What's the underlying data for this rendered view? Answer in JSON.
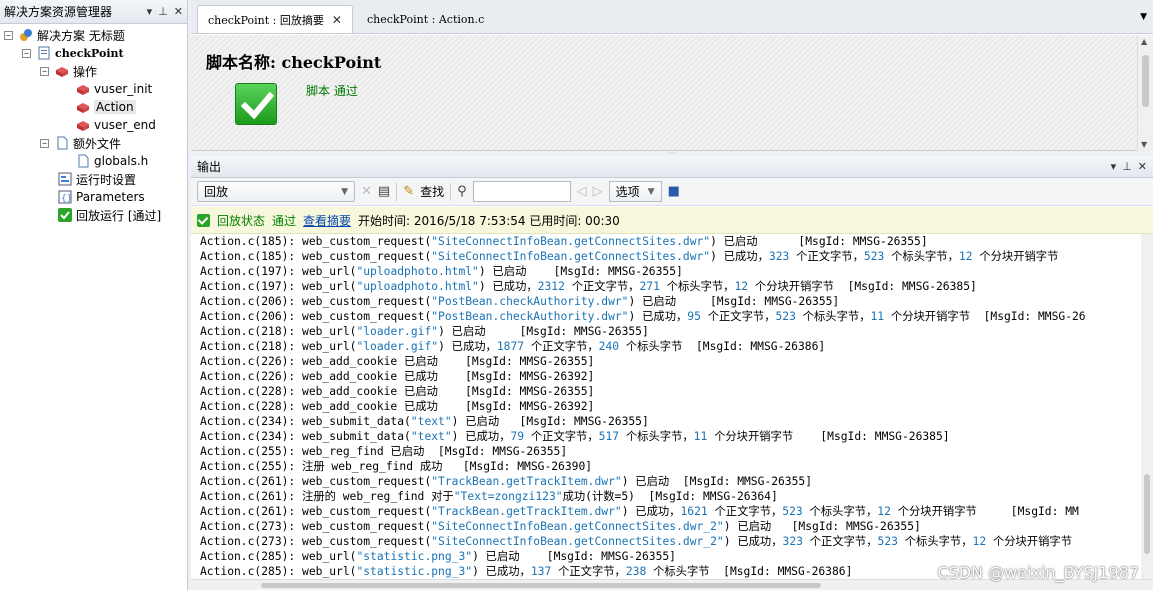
{
  "left_panel": {
    "title": "解决方案资源管理器",
    "buttons": {
      "dropdown": "▾",
      "pin": "⊥",
      "close": "✕"
    },
    "tree": {
      "solution": "解决方案 无标题",
      "script": "checkPoint",
      "actions": "操作",
      "vuser_init": "vuser_init",
      "action": "Action",
      "vuser_end": "vuser_end",
      "extra_files": "额外文件",
      "globals": "globals.h",
      "runtime_settings": "运行时设置",
      "parameters": "Parameters",
      "replay_run": "回放运行 [通过]"
    }
  },
  "tabs": [
    {
      "label": "checkPoint : 回放摘要",
      "close": "✕"
    },
    {
      "label": "checkPoint : Action.c"
    }
  ],
  "tab_menu": "▼",
  "summary": {
    "heading": "脚本名称: checkPoint",
    "result": "脚本 通过"
  },
  "output": {
    "title": "输出",
    "buttons": {
      "dropdown": "▾",
      "pin": "⊥",
      "close": "✕"
    },
    "toolbar": {
      "combo_value": "回放",
      "find_label": "查找",
      "options_label": "选项"
    },
    "status": {
      "state_label": "回放状态",
      "state_value": "通过",
      "summary_link": "查看摘要",
      "time_info": "开始时间: 2016/5/18 7:53:54 已用时间: 00:30"
    },
    "lines": [
      "Action.c(185): web_custom_request(\"SiteConnectInfoBean.getConnectSites.dwr\") 已启动      [MsgId: MMSG-26355]",
      "Action.c(185): web_custom_request(\"SiteConnectInfoBean.getConnectSites.dwr\") 已成功，323 个正文字节，523 个标头字节，12 个分块开销字节",
      "Action.c(197): web_url(\"uploadphoto.html\") 已启动    [MsgId: MMSG-26355]",
      "Action.c(197): web_url(\"uploadphoto.html\") 已成功，2312 个正文字节，271 个标头字节，12 个分块开销字节  [MsgId: MMSG-26385]",
      "Action.c(206): web_custom_request(\"PostBean.checkAuthority.dwr\") 已启动     [MsgId: MMSG-26355]",
      "Action.c(206): web_custom_request(\"PostBean.checkAuthority.dwr\") 已成功，95 个正文字节，523 个标头字节，11 个分块开销字节  [MsgId: MMSG-26",
      "Action.c(218): web_url(\"loader.gif\") 已启动     [MsgId: MMSG-26355]",
      "Action.c(218): web_url(\"loader.gif\") 已成功，1877 个正文字节，240 个标头字节  [MsgId: MMSG-26386]",
      "Action.c(226): web_add_cookie 已启动    [MsgId: MMSG-26355]",
      "Action.c(226): web_add_cookie 已成功    [MsgId: MMSG-26392]",
      "Action.c(228): web_add_cookie 已启动    [MsgId: MMSG-26355]",
      "Action.c(228): web_add_cookie 已成功    [MsgId: MMSG-26392]",
      "Action.c(234): web_submit_data(\"text\") 已启动   [MsgId: MMSG-26355]",
      "Action.c(234): web_submit_data(\"text\") 已成功，79 个正文字节，517 个标头字节，11 个分块开销字节    [MsgId: MMSG-26385]",
      "Action.c(255): web_reg_find 已启动  [MsgId: MMSG-26355]",
      "Action.c(255): 注册 web_reg_find 成功   [MsgId: MMSG-26390]",
      "Action.c(261): web_custom_request(\"TrackBean.getTrackItem.dwr\") 已启动  [MsgId: MMSG-26355]",
      "Action.c(261): 注册的 web_reg_find 对于\"Text=zongzi123\"成功(计数=5)  [MsgId: MMSG-26364]",
      "Action.c(261): web_custom_request(\"TrackBean.getTrackItem.dwr\") 已成功，1621 个正文字节，523 个标头字节，12 个分块开销字节     [MsgId: MM",
      "Action.c(273): web_custom_request(\"SiteConnectInfoBean.getConnectSites.dwr_2\") 已启动   [MsgId: MMSG-26355]",
      "Action.c(273): web_custom_request(\"SiteConnectInfoBean.getConnectSites.dwr_2\") 已成功，323 个正文字节，523 个标头字节，12 个分块开销字节",
      "Action.c(285): web_url(\"statistic.png_3\") 已启动    [MsgId: MMSG-26355]",
      "Action.c(285): web_url(\"statistic.png_3\") 已成功，137 个正文字节，238 个标头字节  [MsgId: MMSG-26386]"
    ]
  },
  "watermark": "CSDN @weixin_BYSJ1987"
}
